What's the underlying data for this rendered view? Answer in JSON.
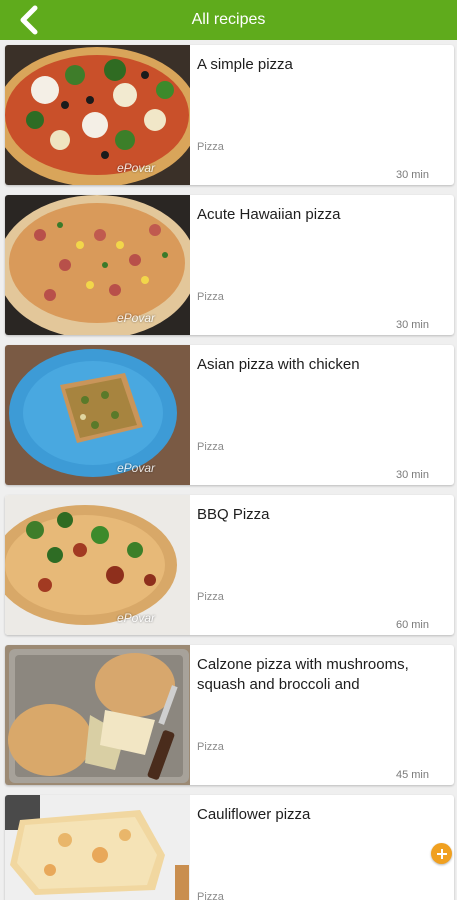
{
  "header": {
    "title": "All recipes",
    "back_icon": "chevron-left-icon",
    "color": "#5fab1c"
  },
  "recipes": [
    {
      "title": "A simple pizza",
      "category": "Pizza",
      "time": "30 min",
      "watermark": "ePovar"
    },
    {
      "title": "Acute Hawaiian pizza",
      "category": "Pizza",
      "time": "30 min",
      "watermark": "ePovar"
    },
    {
      "title": "Asian pizza with chicken",
      "category": "Pizza",
      "time": "30 min",
      "watermark": "ePovar"
    },
    {
      "title": "BBQ Pizza",
      "category": "Pizza",
      "time": "60 min",
      "watermark": "ePovar"
    },
    {
      "title": "Calzone pizza with mushrooms, squash and broccoli and",
      "category": "Pizza",
      "time": "45 min",
      "watermark": ""
    },
    {
      "title": "Cauliflower pizza",
      "category": "Pizza",
      "time": "",
      "watermark": ""
    }
  ],
  "fab": {
    "icon": "plus-icon",
    "color": "#f0a020"
  }
}
